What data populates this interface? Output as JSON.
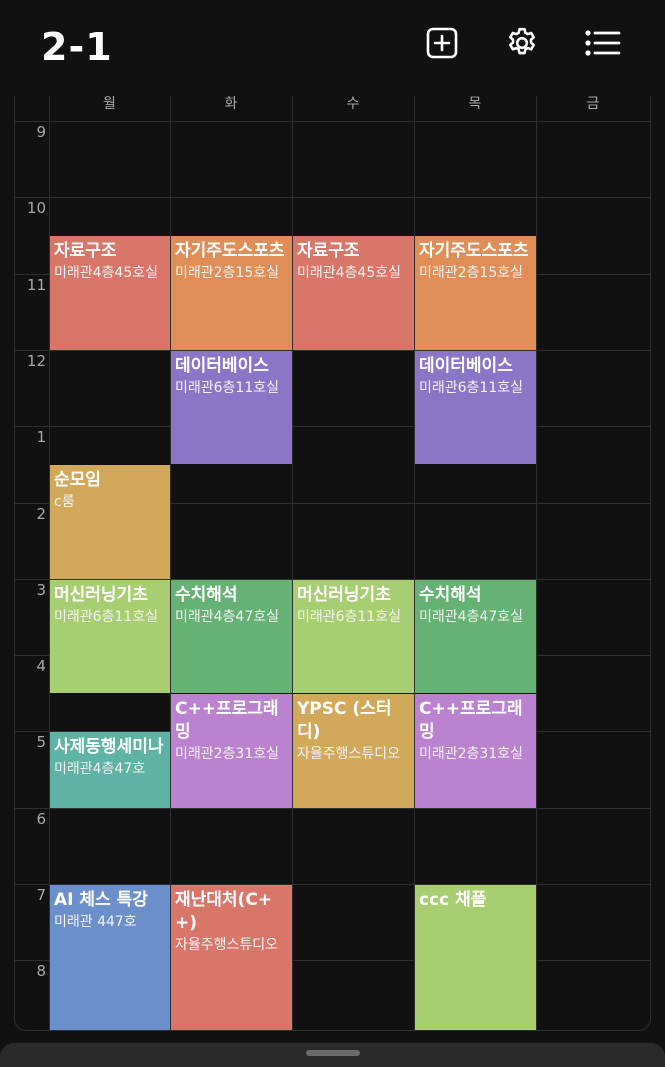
{
  "header": {
    "title": "2-1",
    "icons": [
      "add-square-icon",
      "gear-icon",
      "list-icon"
    ]
  },
  "days": [
    "월",
    "화",
    "수",
    "목",
    "금"
  ],
  "hours": [
    "9",
    "10",
    "11",
    "12",
    "1",
    "2",
    "3",
    "4",
    "5",
    "6",
    "7",
    "8"
  ],
  "courses": [
    {
      "name": "자료구조",
      "room": "미래관4층45호실",
      "day": 0,
      "start": 10.5,
      "end": 12,
      "color": "#d9766a"
    },
    {
      "name": "자기주도스포츠",
      "room": "미래관2층15호실",
      "day": 1,
      "start": 10.5,
      "end": 12,
      "color": "#df8e58"
    },
    {
      "name": "자료구조",
      "room": "미래관4층45호실",
      "day": 2,
      "start": 10.5,
      "end": 12,
      "color": "#d9766a"
    },
    {
      "name": "자기주도스포츠",
      "room": "미래관2층15호실",
      "day": 3,
      "start": 10.5,
      "end": 12,
      "color": "#df8e58"
    },
    {
      "name": "데이터베이스",
      "room": "미래관6층11호실",
      "day": 1,
      "start": 12,
      "end": 13.5,
      "color": "#8b75c6"
    },
    {
      "name": "데이터베이스",
      "room": "미래관6층11호실",
      "day": 3,
      "start": 12,
      "end": 13.5,
      "color": "#8b75c6"
    },
    {
      "name": "순모임",
      "room": "c룸",
      "day": 0,
      "start": 13.5,
      "end": 15,
      "color": "#d2a95a"
    },
    {
      "name": "머신러닝기초",
      "room": "미래관6층11호실",
      "day": 0,
      "start": 15,
      "end": 16.5,
      "color": "#a8ce72"
    },
    {
      "name": "수치해석",
      "room": "미래관4층47호실",
      "day": 1,
      "start": 15,
      "end": 16.5,
      "color": "#66b274"
    },
    {
      "name": "머신러닝기초",
      "room": "미래관6층11호실",
      "day": 2,
      "start": 15,
      "end": 16.5,
      "color": "#a8ce72"
    },
    {
      "name": "수치해석",
      "room": "미래관4층47호실",
      "day": 3,
      "start": 15,
      "end": 16.5,
      "color": "#66b274"
    },
    {
      "name": "사제동행세미나",
      "room": "미래관4층47호",
      "day": 0,
      "start": 17,
      "end": 18,
      "color": "#5fb3a4"
    },
    {
      "name": "C++프로그래밍",
      "room": "미래관2층31호실",
      "day": 1,
      "start": 16.5,
      "end": 18,
      "color": "#bb82cf"
    },
    {
      "name": "YPSC (스터디)",
      "room": "자율주행스튜디오",
      "day": 2,
      "start": 16.5,
      "end": 18,
      "color": "#d2a95a"
    },
    {
      "name": "C++프로그래밍",
      "room": "미래관2층31호실",
      "day": 3,
      "start": 16.5,
      "end": 18,
      "color": "#bb82cf"
    },
    {
      "name": "AI 체스 특강",
      "room": "미래관 447호",
      "day": 0,
      "start": 19,
      "end": 21,
      "color": "#6b8fcb"
    },
    {
      "name": "재난대처(C++)",
      "room": "자율주행스튜디오",
      "day": 1,
      "start": 19,
      "end": 21,
      "color": "#d9766a"
    },
    {
      "name": "ccc 채플",
      "room": "",
      "day": 3,
      "start": 19,
      "end": 21,
      "color": "#a8ce72"
    }
  ]
}
